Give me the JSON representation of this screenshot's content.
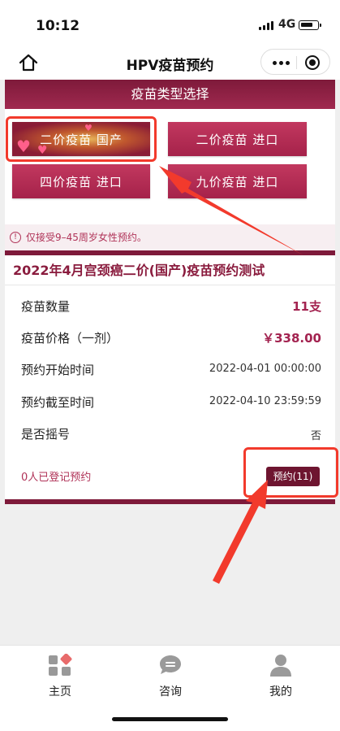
{
  "status_bar": {
    "time": "10:12",
    "network": "4G"
  },
  "nav": {
    "title": "HPV疫苗预约"
  },
  "section": {
    "title": "疫苗类型选择"
  },
  "vaccine_types": [
    {
      "label": "二价疫苗 国产",
      "selected": true
    },
    {
      "label": "二价疫苗 进口",
      "selected": false
    },
    {
      "label": "四价疫苗 进口",
      "selected": false
    },
    {
      "label": "九价疫苗 进口",
      "selected": false
    }
  ],
  "notice": {
    "text": "仅接受9–45周岁女性预约。"
  },
  "appointment": {
    "title": "2022年4月宫颈癌二价(国产)疫苗预约测试",
    "details": [
      {
        "label": "疫苗数量",
        "value": "11支"
      },
      {
        "label": "疫苗价格（一剂）",
        "value": "￥338.00"
      },
      {
        "label": "预约开始时间",
        "value": "2022-04-01 00:00:00"
      },
      {
        "label": "预约截至时间",
        "value": "2022-04-10 23:59:59"
      },
      {
        "label": "是否摇号",
        "value": "否"
      }
    ],
    "registered_text": "0人已登记预约",
    "book_button": "预约(11)"
  },
  "tabbar": [
    {
      "label": "主页",
      "icon": "home-grid-icon"
    },
    {
      "label": "咨询",
      "icon": "chat-icon"
    },
    {
      "label": "我的",
      "icon": "profile-icon"
    }
  ],
  "colors": {
    "primary": "#8a1c3e",
    "accent": "#a32350",
    "highlight": "#f23a2c"
  }
}
